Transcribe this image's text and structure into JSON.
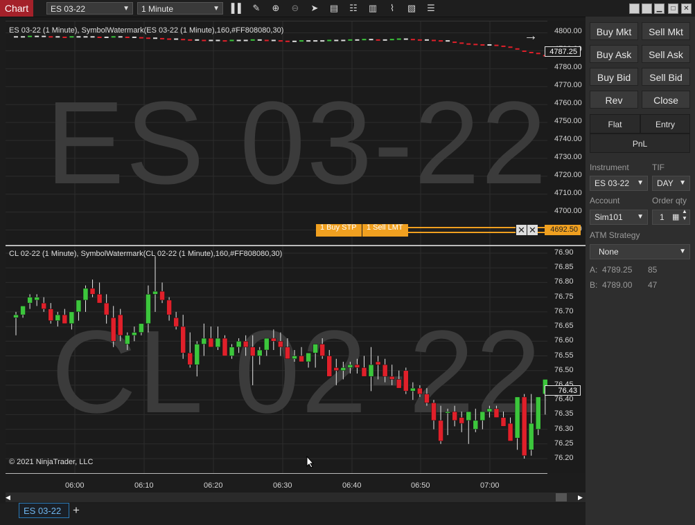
{
  "titlebar": {
    "chart_tab": "Chart",
    "instrument": "ES 03-22",
    "interval": "1 Minute",
    "icons": [
      "bar-type-icon",
      "draw-icon",
      "zoom-in-icon",
      "zoom-out-icon",
      "pointer-icon",
      "data-series-icon",
      "properties-icon",
      "chart-trader-icon",
      "strategies-icon",
      "indicators-icon",
      "list-icon"
    ],
    "window_buttons": [
      "restore",
      "restore",
      "minimize",
      "maximize",
      "close"
    ]
  },
  "top_panel": {
    "label": "ES 03-22 (1 Minute), SymbolWatermark(ES 03-22 (1 Minute),160,#FF808080,30)",
    "watermark": "ES 03-22",
    "ticks": [
      "4800.00",
      "4790.00",
      "4780.00",
      "4770.00",
      "4760.00",
      "4750.00",
      "4740.00",
      "4730.00",
      "4720.00",
      "4710.00",
      "4700.00",
      "4690.00"
    ],
    "last_price": "4787.25",
    "order_price": "4692.50",
    "order_buy": "1  Buy STP",
    "order_sell": "1  Sell LMT"
  },
  "bottom_panel": {
    "label": "CL 02-22 (1 Minute), SymbolWatermark(CL 02-22 (1 Minute),160,#FF808080,30)",
    "watermark": "CL 02-22",
    "ticks": [
      "76.90",
      "76.85",
      "76.80",
      "76.75",
      "76.70",
      "76.65",
      "76.60",
      "76.55",
      "76.50",
      "76.45",
      "76.40",
      "76.35",
      "76.30",
      "76.25",
      "76.20"
    ],
    "last_price": "76.43",
    "copyright": "© 2021 NinjaTrader, LLC"
  },
  "x_axis": [
    "06:00",
    "06:10",
    "06:20",
    "06:30",
    "06:40",
    "06:50",
    "07:00"
  ],
  "chart_data": [
    {
      "type": "line",
      "x": [
        0,
        1,
        2,
        3,
        4,
        5,
        6,
        7,
        8,
        9,
        10,
        11,
        12,
        13,
        14,
        15,
        16,
        17,
        18,
        19,
        20,
        21,
        22,
        23,
        24,
        25,
        26,
        27,
        28,
        29,
        30,
        31,
        32,
        33,
        34,
        35,
        36,
        37,
        38,
        39,
        40,
        41,
        42,
        43,
        44,
        45,
        46,
        47,
        48,
        49,
        50,
        51,
        52,
        53,
        54,
        55,
        56,
        57,
        58,
        59,
        60,
        61,
        62,
        63,
        64,
        65,
        66,
        67,
        68,
        69,
        70,
        71,
        72,
        73,
        74,
        75,
        76
      ],
      "values": [
        4797.75,
        4797.75,
        4798.0,
        4798.0,
        4798.0,
        4797.75,
        4797.75,
        4797.5,
        4797.75,
        4797.75,
        4797.75,
        4797.75,
        4797.5,
        4797.5,
        4797.75,
        4797.75,
        4797.5,
        4797.5,
        4797.25,
        4797.0,
        4797.0,
        4796.75,
        4796.5,
        4796.5,
        4796.25,
        4796.0,
        4796.0,
        4795.75,
        4795.75,
        4795.75,
        4795.5,
        4795.75,
        4795.75,
        4795.75,
        4796.0,
        4796.0,
        4795.75,
        4795.75,
        4795.5,
        4795.25,
        4795.25,
        4795.5,
        4795.5,
        4795.5,
        4795.5,
        4795.75,
        4795.75,
        4795.75,
        4796.0,
        4796.0,
        4796.25,
        4796.25,
        4796.0,
        4796.0,
        4796.25,
        4796.5,
        4796.5,
        4796.25,
        4796.0,
        4796.0,
        4795.75,
        4795.5,
        4795.5,
        4794.75,
        4794.25,
        4793.75,
        4793.5,
        4793.25,
        4793.25,
        4793.0,
        4792.5,
        4792.0,
        4791.0,
        4789.75,
        4789.0,
        4788.5,
        4787.25
      ],
      "ylim": [
        4687.5,
        4802.5
      ]
    },
    {
      "type": "candlestick",
      "open": [
        76.68,
        76.69,
        76.73,
        76.74,
        76.73,
        76.71,
        76.67,
        76.69,
        76.66,
        76.7,
        76.74,
        76.78,
        76.76,
        76.73,
        76.68,
        76.69,
        76.59,
        76.62,
        76.63,
        76.66,
        76.76,
        76.77,
        76.74,
        76.68,
        76.65,
        76.56,
        76.52,
        76.59,
        76.61,
        76.58,
        76.61,
        76.55,
        76.58,
        76.6,
        76.58,
        76.55,
        76.57,
        76.61,
        76.6,
        76.58,
        76.54,
        76.55,
        76.53,
        76.56,
        76.59,
        76.55,
        76.51,
        76.5,
        76.51,
        76.52,
        76.51,
        76.48,
        76.53,
        76.52,
        76.48,
        76.47,
        76.5,
        76.43,
        76.44,
        76.42,
        76.39,
        76.33,
        76.36,
        76.36,
        76.34,
        76.33,
        76.3,
        76.33,
        76.36,
        76.37,
        76.34,
        76.32,
        76.27,
        76.41,
        76.23,
        76.3,
        76.42,
        76.47,
        76.52,
        76.42
      ],
      "high": [
        76.7,
        76.72,
        76.76,
        76.76,
        76.75,
        76.73,
        76.7,
        76.71,
        76.69,
        76.72,
        76.79,
        76.81,
        76.8,
        76.76,
        76.72,
        76.71,
        76.63,
        76.65,
        76.66,
        76.79,
        76.89,
        76.8,
        76.75,
        76.7,
        76.69,
        76.63,
        76.6,
        76.66,
        76.65,
        76.65,
        76.62,
        76.59,
        76.61,
        76.62,
        76.62,
        76.58,
        76.6,
        76.64,
        76.63,
        76.61,
        76.57,
        76.58,
        76.56,
        76.59,
        76.61,
        76.57,
        76.54,
        76.53,
        76.53,
        76.54,
        76.55,
        76.58,
        76.55,
        76.54,
        76.52,
        76.5,
        76.51,
        76.46,
        76.45,
        76.44,
        76.4,
        76.38,
        76.37,
        76.38,
        76.36,
        76.35,
        76.37,
        76.36,
        76.38,
        76.38,
        76.36,
        76.34,
        76.33,
        76.42,
        76.42,
        76.4,
        76.46,
        76.5,
        76.55,
        76.53
      ],
      "low": [
        76.62,
        76.68,
        76.71,
        76.72,
        76.7,
        76.66,
        76.65,
        76.66,
        76.64,
        76.67,
        76.7,
        76.75,
        76.73,
        76.66,
        76.58,
        76.6,
        76.57,
        76.6,
        76.62,
        76.63,
        76.7,
        76.73,
        76.67,
        76.64,
        76.54,
        76.51,
        76.48,
        76.55,
        76.58,
        76.57,
        76.56,
        76.54,
        76.56,
        76.55,
        76.45,
        76.52,
        76.55,
        76.57,
        76.55,
        76.54,
        76.53,
        76.53,
        76.51,
        76.51,
        76.54,
        76.48,
        76.45,
        76.47,
        76.49,
        76.49,
        76.49,
        76.43,
        76.47,
        76.46,
        76.45,
        76.44,
        76.42,
        76.4,
        76.41,
        76.38,
        76.3,
        76.25,
        76.28,
        76.31,
        76.29,
        76.25,
        76.29,
        76.3,
        76.34,
        76.34,
        76.31,
        76.27,
        76.23,
        76.2,
        76.21,
        76.28,
        76.35,
        76.41,
        76.45,
        76.4
      ],
      "close": [
        76.69,
        76.72,
        76.75,
        76.75,
        76.71,
        76.67,
        76.69,
        76.66,
        76.7,
        76.74,
        76.78,
        76.76,
        76.73,
        76.69,
        76.6,
        76.62,
        76.62,
        76.63,
        76.66,
        76.76,
        76.77,
        76.74,
        76.69,
        76.65,
        76.56,
        76.52,
        76.59,
        76.61,
        76.58,
        76.61,
        76.55,
        76.58,
        76.6,
        76.58,
        76.55,
        76.57,
        76.61,
        76.6,
        76.58,
        76.54,
        76.55,
        76.53,
        76.56,
        76.59,
        76.55,
        76.48,
        76.5,
        76.51,
        76.52,
        76.51,
        76.48,
        76.52,
        76.52,
        76.48,
        76.47,
        76.44,
        76.43,
        76.44,
        76.42,
        76.39,
        76.33,
        76.26,
        76.36,
        76.33,
        76.32,
        76.36,
        76.33,
        76.36,
        76.37,
        76.34,
        76.31,
        76.26,
        76.41,
        76.21,
        76.32,
        76.41,
        76.47,
        76.52,
        76.42,
        76.44
      ],
      "ylim": [
        76.17,
        76.92
      ]
    }
  ],
  "side": {
    "buy_mkt": "Buy Mkt",
    "sell_mkt": "Sell Mkt",
    "buy_ask": "Buy Ask",
    "sell_ask": "Sell Ask",
    "buy_bid": "Buy Bid",
    "sell_bid": "Sell Bid",
    "rev": "Rev",
    "close": "Close",
    "flat": "Flat",
    "entry": "Entry",
    "pnl": "PnL",
    "instrument_label": "Instrument",
    "instrument_value": "ES 03-22",
    "tif_label": "TIF",
    "tif_value": "DAY",
    "account_label": "Account",
    "account_value": "Sim101",
    "order_qty_label": "Order qty",
    "order_qty_value": "1",
    "atm_label": "ATM Strategy",
    "atm_value": "None",
    "ask_label": "A:",
    "ask_price": "4789.25",
    "ask_size": "85",
    "bid_label": "B:",
    "bid_price": "4789.00",
    "bid_size": "47"
  },
  "bottom_tabs": {
    "active": "ES 03-22",
    "add": "+"
  },
  "colors": {
    "up": "#3cc63c",
    "down": "#e0202a",
    "accent_red": "#a4212a",
    "order_orange": "#f0a020",
    "tab_blue": "#2a7ab8"
  }
}
